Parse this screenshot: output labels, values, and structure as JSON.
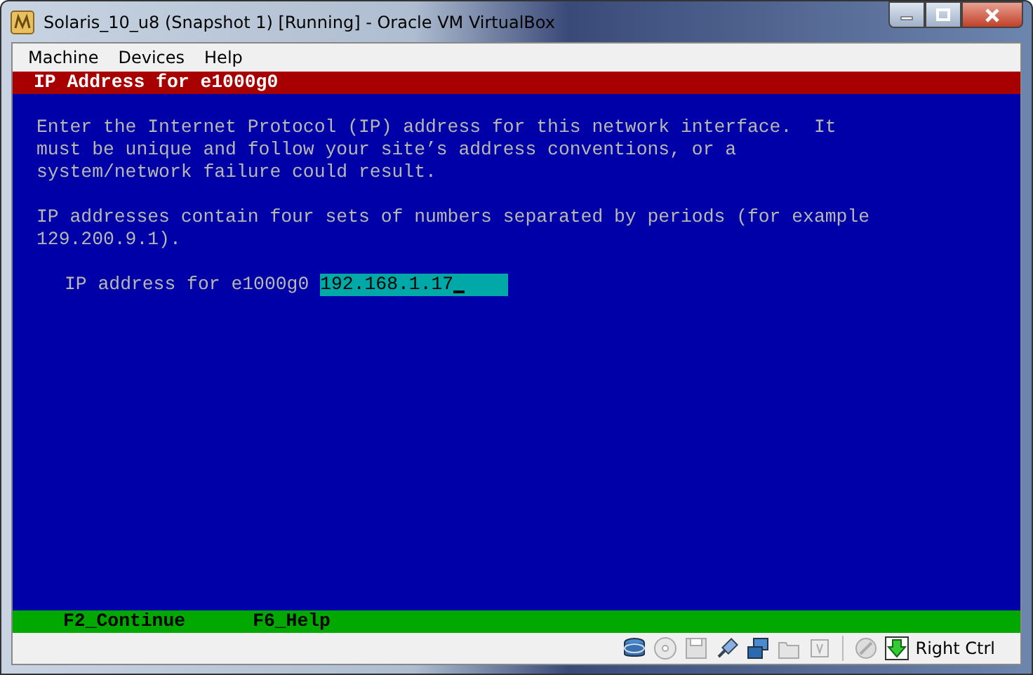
{
  "window": {
    "title": "Solaris_10_u8 (Snapshot 1) [Running] - Oracle VM VirtualBox"
  },
  "menu": [
    "Machine",
    "Devices",
    "Help"
  ],
  "screen": {
    "header": "IP Address for e1000g0",
    "paragraphs": [
      [
        "Enter the Internet Protocol (IP) address for this network interface.  It",
        "must be unique and follow your site’s address conventions, or a",
        "system/network failure could result."
      ],
      [
        "IP addresses contain four sets of numbers separated by periods (for example",
        "129.200.9.1)."
      ]
    ],
    "field": {
      "label": "IP address for e1000g0",
      "value": "192.168.1.17"
    },
    "keys": [
      "F2_Continue",
      "F6_Help"
    ]
  },
  "status_bar": {
    "host_key": "Right Ctrl"
  }
}
